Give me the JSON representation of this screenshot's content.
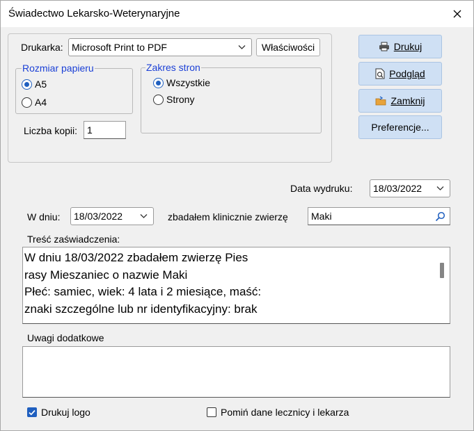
{
  "window": {
    "title": "Świadectwo Lekarsko-Weterynaryjne"
  },
  "printer": {
    "label": "Drukarka:",
    "selected": "Microsoft Print to PDF",
    "properties_button": "Właściwości"
  },
  "paper_size": {
    "legend": "Rozmiar papieru",
    "options": [
      {
        "label": "A5",
        "selected": true
      },
      {
        "label": "A4",
        "selected": false
      }
    ]
  },
  "page_range": {
    "legend": "Zakres stron",
    "options": [
      {
        "label": "Wszystkie",
        "selected": true
      },
      {
        "label": "Strony",
        "selected": false
      }
    ]
  },
  "copies": {
    "label": "Liczba kopii:",
    "value": "1"
  },
  "side_buttons": {
    "print": "Drukuj",
    "preview": "Podgląd",
    "close": "Zamknij",
    "preferences": "Preferencje..."
  },
  "print_date": {
    "label": "Data wydruku:",
    "value": "18/03/2022"
  },
  "exam": {
    "day_label": "W dniu:",
    "day_value": "18/03/2022",
    "examined_label": "zbadałem klinicznie zwierzę",
    "animal_value": "Maki"
  },
  "certificate": {
    "label": "Treść zaświadczenia:",
    "lines": [
      "W dniu 18/03/2022 zbadałem zwierzę Pies",
      "rasy Mieszaniec o nazwie Maki",
      "Płeć: samiec, wiek: 4 lata i 2 miesiące, maść:",
      "znaki szczególne lub nr identyfikacyjny: brak"
    ]
  },
  "notes": {
    "label": "Uwagi dodatkowe",
    "value": ""
  },
  "options": {
    "print_logo": {
      "label": "Drukuj logo",
      "checked": true
    },
    "skip_clinic": {
      "label": "Pomiń dane lecznicy i lekarza",
      "checked": false
    }
  }
}
